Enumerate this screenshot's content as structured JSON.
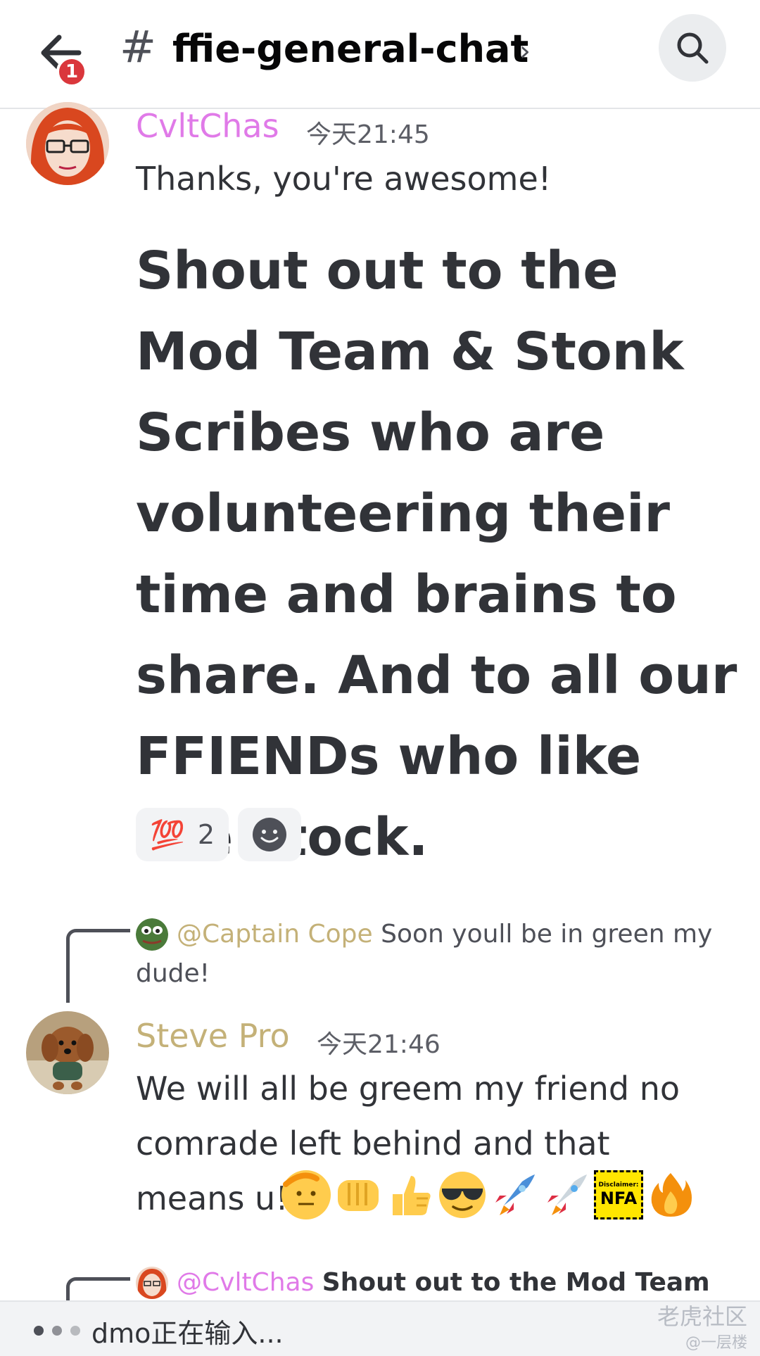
{
  "header": {
    "back_badge": "1",
    "hash": "#",
    "channel": "ffie-general-chat",
    "chevron": "›"
  },
  "messages": [
    {
      "author": "CvltChas",
      "author_color": "#e07ae8",
      "time": "今天21:45",
      "text": "Thanks, you're awesome!",
      "big_text": "Shout out to the Mod Team & Stonk Scribes who are volunteering their time and brains to share. And to all our FFIENDs who like the stock.",
      "reactions": [
        {
          "emoji": "💯",
          "count": "2"
        }
      ]
    },
    {
      "reply": {
        "mention": "@Captain Cope",
        "text": "Soon youll be in green my dude!"
      },
      "author": "Steve Pro",
      "author_color": "#c4b178",
      "time": "今天21:46",
      "text_line1": "We will all be greem my friend no",
      "text_line2": "comrade  left behind and that",
      "text_line3": "means u!",
      "emojis": [
        "🫡",
        "👊",
        "👍",
        "😎",
        "🚀",
        "🚀",
        "NFA",
        "🔥"
      ],
      "nfa_label": "Disclaimer:"
    },
    {
      "reply": {
        "mention": "@CvltChas",
        "text": "Shout out to the Mod Team &"
      }
    }
  ],
  "typing": {
    "text": "dmo正在输入..."
  },
  "watermark": {
    "line1": "老虎社区",
    "line2": "@一层楼"
  }
}
